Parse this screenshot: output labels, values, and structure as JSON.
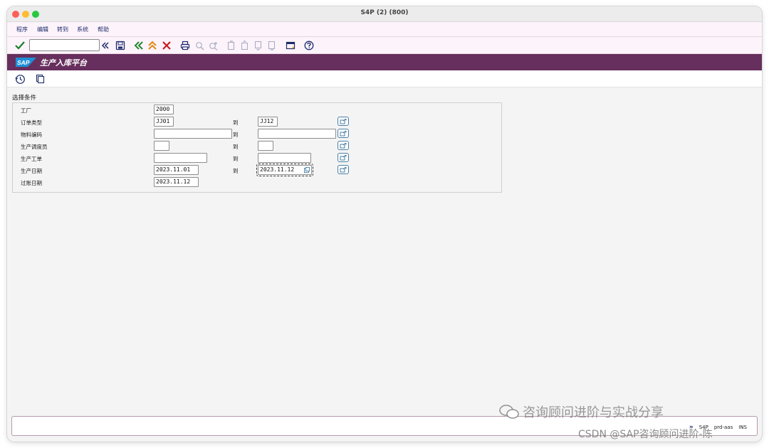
{
  "window": {
    "title": "S4P (2) (800)"
  },
  "menu": [
    "程序",
    "编辑",
    "转到",
    "系统",
    "帮助"
  ],
  "toolbar": {
    "command_value": ""
  },
  "app": {
    "logo_text": "SAP",
    "title": "生产入库平台"
  },
  "form": {
    "section_title": "选择条件",
    "to_label": "到",
    "rows": [
      {
        "label": "工厂",
        "low": "2000",
        "high": null
      },
      {
        "label": "订单类型",
        "low": "JJ01",
        "high": "JJ12"
      },
      {
        "label": "物料编码",
        "low": "",
        "high": ""
      },
      {
        "label": "生产调度员",
        "low": "",
        "high": ""
      },
      {
        "label": "生产工单",
        "low": "",
        "high": ""
      },
      {
        "label": "生产日期",
        "low": "2023.11.01",
        "high": "2023.11.12"
      },
      {
        "label": "过账日期",
        "low": "2023.11.12",
        "high": null
      }
    ]
  },
  "status": {
    "system": "S4P",
    "server": "prd-aas",
    "mode": "INS"
  },
  "watermark": {
    "line1": "咨询顾问进阶与实战分享",
    "line2": "CSDN @SAP咨询顾问进阶-陈"
  },
  "colors": {
    "app_title_bg": "#672f5d",
    "menu_bg": "#fdf3fb",
    "accent_blue": "#4a7fa6"
  }
}
